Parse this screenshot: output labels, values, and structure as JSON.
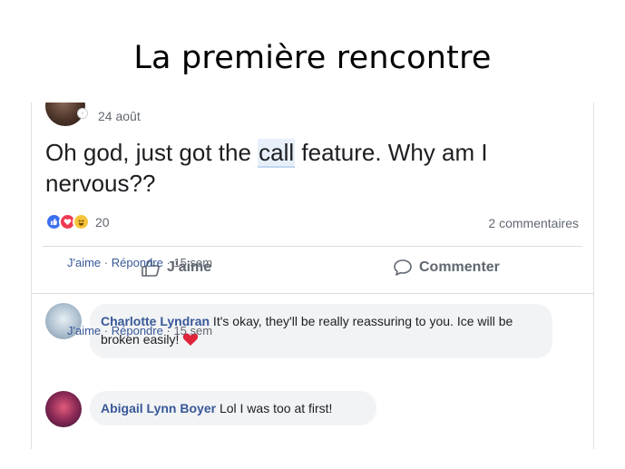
{
  "slide": {
    "title": "La première rencontre"
  },
  "post": {
    "date": "24 août",
    "text_before": "Oh god, just got the ",
    "text_highlight": "call",
    "text_after": " feature. Why am I nervous??",
    "reaction_count": "20",
    "comment_count": "2 commentaires",
    "reactions": [
      "like-icon",
      "love-icon",
      "haha-icon"
    ]
  },
  "actions": {
    "like_label": "J'aime",
    "comment_label": "Commenter"
  },
  "comments": [
    {
      "author": "Charlotte Lyndran",
      "text": " It's okay, they'll be really reassuring to you. Ice will be broken easily! ",
      "like": "J'aime",
      "reply": "Répondre",
      "time": "15 sem"
    },
    {
      "author": "Abigail Lynn Boyer",
      "text": " Lol I was too at first!",
      "like": "J'aime",
      "reply": "Répondre",
      "time": "15 sem"
    }
  ],
  "colors": {
    "link": "#385898",
    "like": "#3b6ff0",
    "love": "#ef3a52",
    "haha": "#f7c53a",
    "bubble": "#f2f3f5"
  }
}
